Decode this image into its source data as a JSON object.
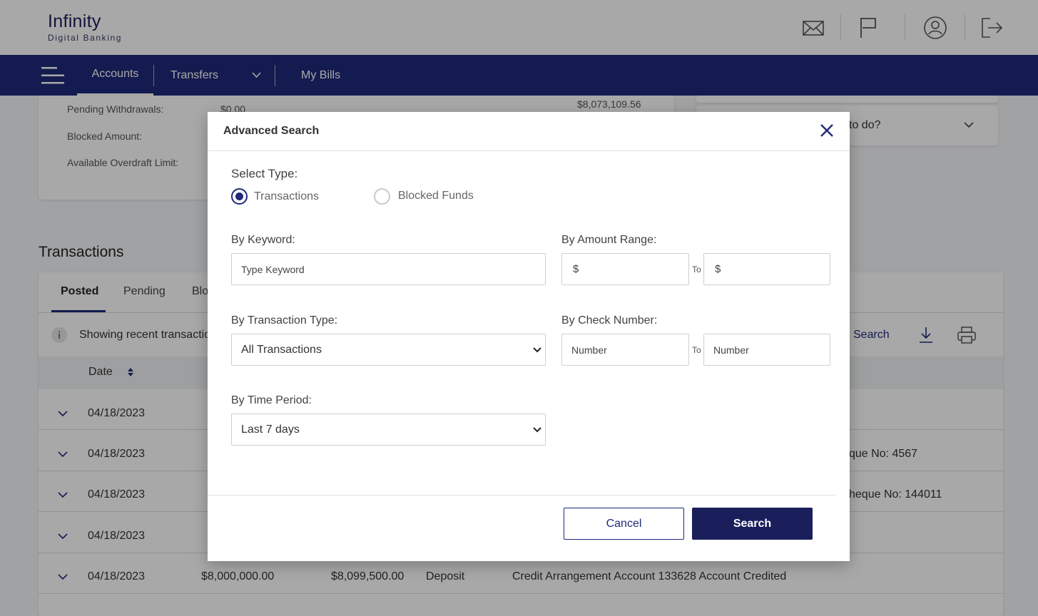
{
  "brand": {
    "name": "Infinity",
    "tagline": "Digital Banking"
  },
  "header_icons": [
    "envelope-icon",
    "flag-icon",
    "user-icon",
    "logout-icon"
  ],
  "nav": {
    "accounts": "Accounts",
    "transfers": "Transfers",
    "my_bills": "My Bills"
  },
  "account_summary": {
    "pending_withdrawals_label": "Pending Withdrawals:",
    "pending_withdrawals_value": "$0.00",
    "blocked_amount_label": "Blocked Amount:",
    "available_overdraft_label": "Available Overdraft Limit:",
    "balance_value": "$8,073,109.56"
  },
  "quick_action": {
    "text": "to do?"
  },
  "transactions": {
    "title": "Transactions",
    "tabs": [
      "Posted",
      "Pending",
      "Blo"
    ],
    "info_text": "Showing recent transactio",
    "search_link": "Search",
    "date_header": "Date",
    "rows": [
      {
        "date": "04/18/2023",
        "desc": ""
      },
      {
        "date": "04/18/2023",
        "desc": "que No: 4567"
      },
      {
        "date": "04/18/2023",
        "desc": "heque No: 144011"
      },
      {
        "date": "04/18/2023",
        "desc": ""
      },
      {
        "date": "04/18/2023",
        "amount": "$8,000,000.00",
        "balance": "$8,099,500.00",
        "type": "Deposit",
        "desc": "Credit Arrangement Account 133628 Account Credited"
      }
    ]
  },
  "modal": {
    "title": "Advanced Search",
    "select_type_label": "Select Type:",
    "type_options": [
      "Transactions",
      "Blocked Funds"
    ],
    "selected_type": "Transactions",
    "keyword_label": "By Keyword:",
    "keyword_placeholder": "Type Keyword",
    "amount_label": "By Amount Range:",
    "currency_symbol": "$",
    "to_label": "To",
    "transaction_type_label": "By Transaction Type:",
    "transaction_type_value": "All Transactions",
    "check_label": "By Check Number:",
    "check_placeholder": "Number",
    "time_period_label": "By Time Period:",
    "time_period_value": "Last 7 days",
    "cancel_label": "Cancel",
    "search_label": "Search"
  },
  "colors": {
    "primary": "#1f2a7a",
    "primary_dark": "#1a1f5c",
    "overlay": "rgba(0,0,0,0.34)"
  }
}
